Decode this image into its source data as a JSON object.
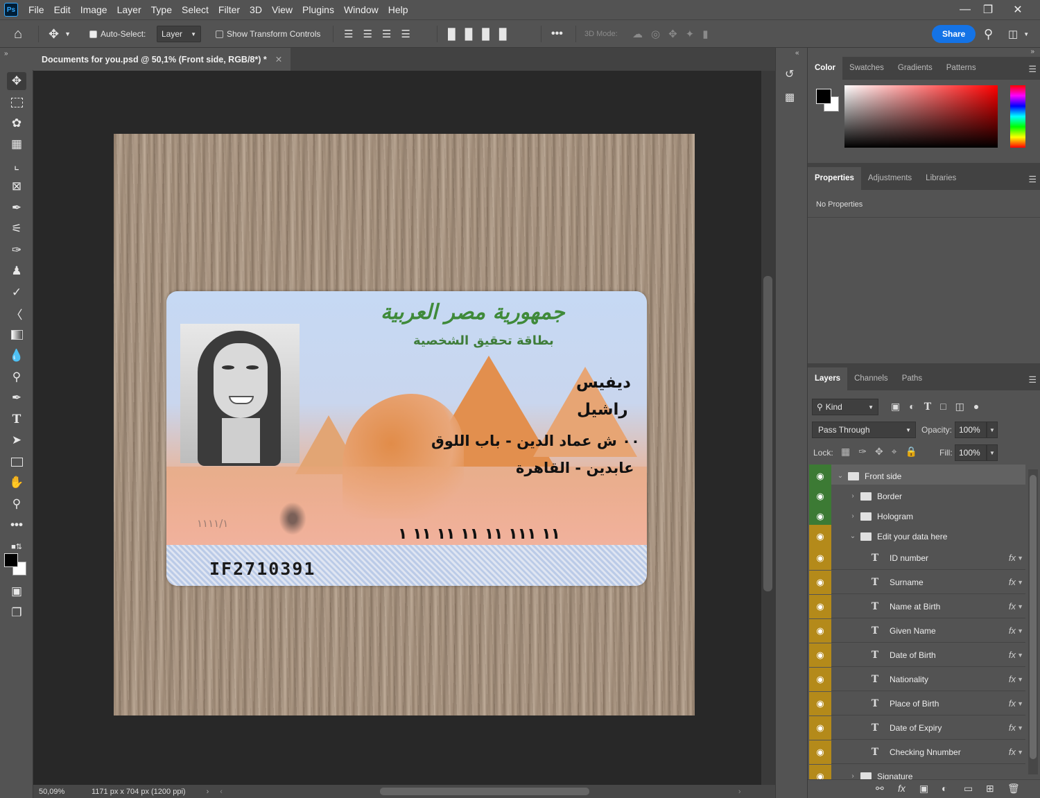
{
  "menu": [
    "File",
    "Edit",
    "Image",
    "Layer",
    "Type",
    "Select",
    "Filter",
    "3D",
    "View",
    "Plugins",
    "Window",
    "Help"
  ],
  "app_icon": "Ps",
  "options": {
    "auto_select_label": "Auto-Select:",
    "auto_select_checked": true,
    "auto_select_target": "Layer",
    "show_transform_label": "Show Transform Controls",
    "show_transform_checked": false,
    "mode_3d_label": "3D Mode:",
    "share_label": "Share"
  },
  "document": {
    "tab_title": "Documents for you.psd @ 50,1% (Front side, RGB/8*) *",
    "zoom": "50,09%",
    "dimensions": "1171 px x 704 px (1200 ppi)"
  },
  "card": {
    "header_line1": "جمهورية مصر العربية",
    "header_line2": "بطاقة تحقيق الشخصية",
    "given_name": "ديفيس",
    "surname": "راشيل",
    "address_line1": "٠٠ ش عماد الدين - باب اللوق",
    "address_line2": "عابدين - القاهرة",
    "number_ar": "١١ ١١١ ١١ ١١ ١١ ١١ ١",
    "small_number": "١١١١/١",
    "card_id": "IF2710391"
  },
  "color_panel": {
    "tabs": [
      "Color",
      "Swatches",
      "Gradients",
      "Patterns"
    ],
    "active_tab": "Color",
    "foreground": "#000000",
    "background": "#ffffff",
    "hue_color": "#ff0000"
  },
  "properties_panel": {
    "tabs": [
      "Properties",
      "Adjustments",
      "Libraries"
    ],
    "active_tab": "Properties",
    "message": "No Properties"
  },
  "layers_panel": {
    "tabs": [
      "Layers",
      "Channels",
      "Paths"
    ],
    "active_tab": "Layers",
    "filter_kind": "Kind",
    "blend_mode": "Pass Through",
    "opacity_label": "Opacity:",
    "opacity": "100%",
    "lock_label": "Lock:",
    "fill_label": "Fill:",
    "fill": "100%",
    "layers": [
      {
        "name": "Front side",
        "type": "group",
        "expanded": true,
        "indent": 0,
        "eye": "green"
      },
      {
        "name": "Border",
        "type": "group",
        "expanded": false,
        "indent": 1,
        "eye": "green"
      },
      {
        "name": "Hologram",
        "type": "group",
        "expanded": false,
        "indent": 1,
        "eye": "green"
      },
      {
        "name": "Edit your data here",
        "type": "group",
        "expanded": true,
        "indent": 1,
        "eye": "yellow"
      },
      {
        "name": "ID number",
        "type": "text",
        "indent": 2,
        "eye": "yellow",
        "fx": true
      },
      {
        "name": "Surname",
        "type": "text",
        "indent": 2,
        "eye": "yellow",
        "fx": true
      },
      {
        "name": "Name at Birth",
        "type": "text",
        "indent": 2,
        "eye": "yellow",
        "fx": true
      },
      {
        "name": "Given Name",
        "type": "text",
        "indent": 2,
        "eye": "yellow",
        "fx": true
      },
      {
        "name": "Date of Birth",
        "type": "text",
        "indent": 2,
        "eye": "yellow",
        "fx": true
      },
      {
        "name": "Nationality",
        "type": "text",
        "indent": 2,
        "eye": "yellow",
        "fx": true
      },
      {
        "name": "Place of Birth",
        "type": "text",
        "indent": 2,
        "eye": "yellow",
        "fx": true
      },
      {
        "name": "Date of Expiry",
        "type": "text",
        "indent": 2,
        "eye": "yellow",
        "fx": true
      },
      {
        "name": "Checking Nnumber",
        "type": "text",
        "indent": 2,
        "eye": "yellow",
        "fx": true
      },
      {
        "name": "Signature",
        "type": "group",
        "expanded": false,
        "indent": 1,
        "eye": "yellow"
      }
    ]
  }
}
